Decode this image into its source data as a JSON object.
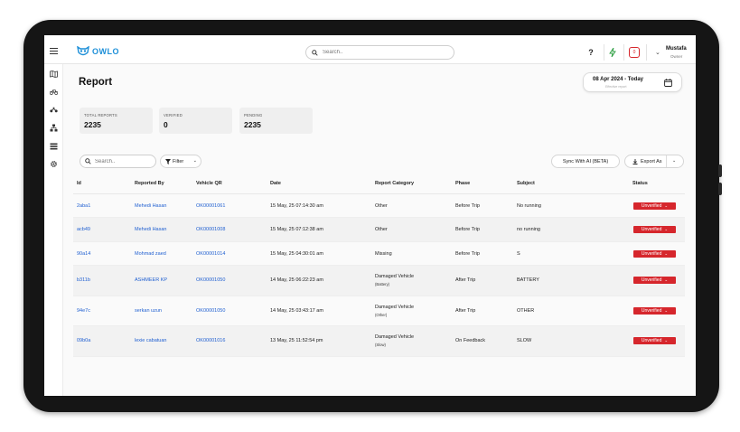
{
  "app": {
    "logo_text": "OWLO",
    "brand_color": "#1d8fd8"
  },
  "header": {
    "search_placeholder": "Search..",
    "help_label": "?",
    "notification_count": "0",
    "user_name": "Mustafa",
    "user_role": "Owner"
  },
  "sidebar": {
    "icons": [
      "hamburger-icon",
      "map-icon",
      "bicycle-icon",
      "motorbike-icon",
      "network-icon",
      "list-icon",
      "gear-icon"
    ]
  },
  "page": {
    "title": "Report",
    "date_range": "08 Apr 2024 - Today",
    "date_hint": "Effective report"
  },
  "stats": [
    {
      "label": "TOTAL REPORTS",
      "value": "2235"
    },
    {
      "label": "VERIFIED",
      "value": "0"
    },
    {
      "label": "PENDING",
      "value": "2235"
    }
  ],
  "toolbar": {
    "search_placeholder": "Search..",
    "filter_label": "Filter",
    "sync_label": "Sync With AI (BETA)",
    "export_label": "Export As"
  },
  "table": {
    "headers": [
      "Id",
      "Reported By",
      "Vehicle QR",
      "Date",
      "Report Category",
      "Phase",
      "Subject",
      "Status"
    ],
    "rows": [
      {
        "id": "2aba1",
        "reporter": "Mehedi Hasan",
        "qr": "OK00001061",
        "date": "15 May, 25 07:14:30 am",
        "category": "Other",
        "category_detail": "",
        "phase": "Before Trip",
        "subject": "No running",
        "status": "Unverified"
      },
      {
        "id": "acb49",
        "reporter": "Mehedi Hasan",
        "qr": "OK00001008",
        "date": "15 May, 25 07:12:38 am",
        "category": "Other",
        "category_detail": "",
        "phase": "Before Trip",
        "subject": "no running",
        "status": "Unverified"
      },
      {
        "id": "90a14",
        "reporter": "Mohmad zaed",
        "qr": "OK00001014",
        "date": "15 May, 25 04:30:01 am",
        "category": "Missing",
        "category_detail": "",
        "phase": "Before Trip",
        "subject": "S",
        "status": "Unverified"
      },
      {
        "id": "b311b",
        "reporter": "ASHMEER KP",
        "qr": "OK00001050",
        "date": "14 May, 25 06:22:23 am",
        "category": "Damaged Vehicle",
        "category_detail": "(Battery)",
        "phase": "After Trip",
        "subject": "BATTERY",
        "status": "Unverified"
      },
      {
        "id": "94e7c",
        "reporter": "serkan uzun",
        "qr": "OK00001050",
        "date": "14 May, 25 03:43:17 am",
        "category": "Damaged Vehicle",
        "category_detail": "(Other)",
        "phase": "After Trip",
        "subject": "OTHER",
        "status": "Unverified"
      },
      {
        "id": "09b0a",
        "reporter": "lexie cabatuan",
        "qr": "OK00001016",
        "date": "13 May, 25 11:52:54 pm",
        "category": "Damaged Vehicle",
        "category_detail": "(Slow)",
        "phase": "On Feedback",
        "subject": "SLOW",
        "status": "Unverified"
      }
    ]
  },
  "colors": {
    "status_unverified": "#d6262c",
    "link": "#1f5fd1"
  }
}
